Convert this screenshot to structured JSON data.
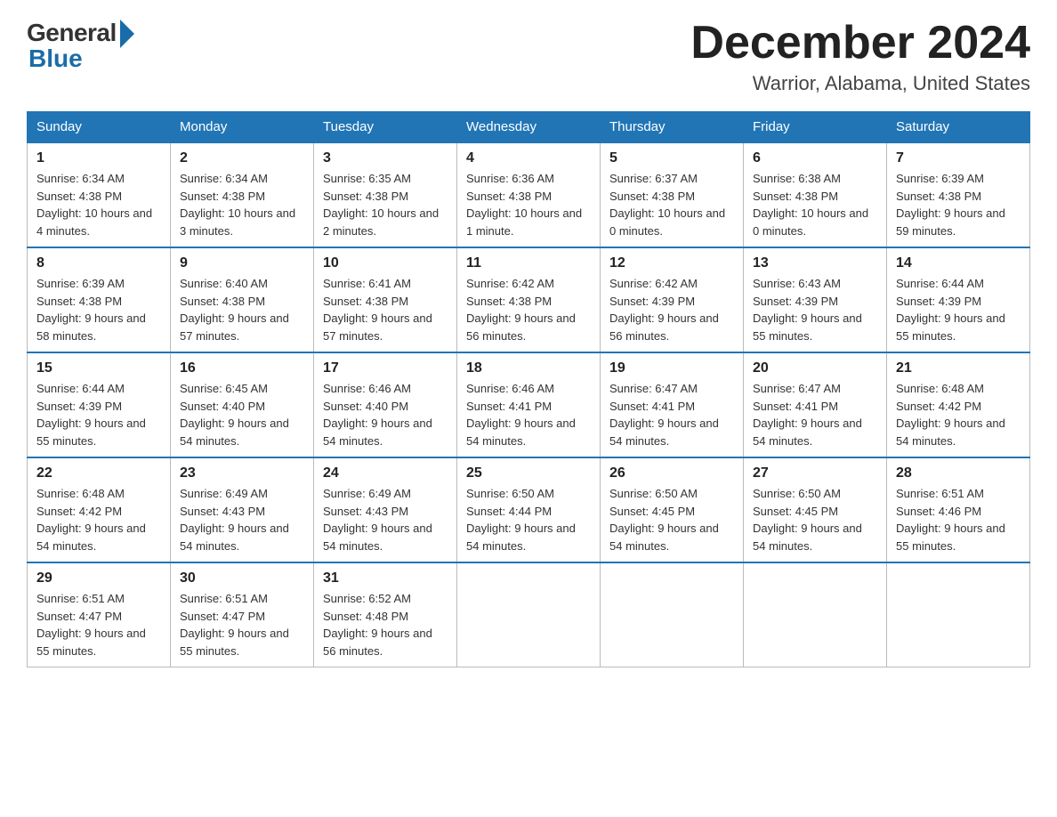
{
  "header": {
    "logo_general": "General",
    "logo_blue": "Blue",
    "month_title": "December 2024",
    "location": "Warrior, Alabama, United States"
  },
  "calendar": {
    "days_of_week": [
      "Sunday",
      "Monday",
      "Tuesday",
      "Wednesday",
      "Thursday",
      "Friday",
      "Saturday"
    ],
    "weeks": [
      [
        {
          "day": "1",
          "sunrise": "6:34 AM",
          "sunset": "4:38 PM",
          "daylight": "10 hours and 4 minutes."
        },
        {
          "day": "2",
          "sunrise": "6:34 AM",
          "sunset": "4:38 PM",
          "daylight": "10 hours and 3 minutes."
        },
        {
          "day": "3",
          "sunrise": "6:35 AM",
          "sunset": "4:38 PM",
          "daylight": "10 hours and 2 minutes."
        },
        {
          "day": "4",
          "sunrise": "6:36 AM",
          "sunset": "4:38 PM",
          "daylight": "10 hours and 1 minute."
        },
        {
          "day": "5",
          "sunrise": "6:37 AM",
          "sunset": "4:38 PM",
          "daylight": "10 hours and 0 minutes."
        },
        {
          "day": "6",
          "sunrise": "6:38 AM",
          "sunset": "4:38 PM",
          "daylight": "10 hours and 0 minutes."
        },
        {
          "day": "7",
          "sunrise": "6:39 AM",
          "sunset": "4:38 PM",
          "daylight": "9 hours and 59 minutes."
        }
      ],
      [
        {
          "day": "8",
          "sunrise": "6:39 AM",
          "sunset": "4:38 PM",
          "daylight": "9 hours and 58 minutes."
        },
        {
          "day": "9",
          "sunrise": "6:40 AM",
          "sunset": "4:38 PM",
          "daylight": "9 hours and 57 minutes."
        },
        {
          "day": "10",
          "sunrise": "6:41 AM",
          "sunset": "4:38 PM",
          "daylight": "9 hours and 57 minutes."
        },
        {
          "day": "11",
          "sunrise": "6:42 AM",
          "sunset": "4:38 PM",
          "daylight": "9 hours and 56 minutes."
        },
        {
          "day": "12",
          "sunrise": "6:42 AM",
          "sunset": "4:39 PM",
          "daylight": "9 hours and 56 minutes."
        },
        {
          "day": "13",
          "sunrise": "6:43 AM",
          "sunset": "4:39 PM",
          "daylight": "9 hours and 55 minutes."
        },
        {
          "day": "14",
          "sunrise": "6:44 AM",
          "sunset": "4:39 PM",
          "daylight": "9 hours and 55 minutes."
        }
      ],
      [
        {
          "day": "15",
          "sunrise": "6:44 AM",
          "sunset": "4:39 PM",
          "daylight": "9 hours and 55 minutes."
        },
        {
          "day": "16",
          "sunrise": "6:45 AM",
          "sunset": "4:40 PM",
          "daylight": "9 hours and 54 minutes."
        },
        {
          "day": "17",
          "sunrise": "6:46 AM",
          "sunset": "4:40 PM",
          "daylight": "9 hours and 54 minutes."
        },
        {
          "day": "18",
          "sunrise": "6:46 AM",
          "sunset": "4:41 PM",
          "daylight": "9 hours and 54 minutes."
        },
        {
          "day": "19",
          "sunrise": "6:47 AM",
          "sunset": "4:41 PM",
          "daylight": "9 hours and 54 minutes."
        },
        {
          "day": "20",
          "sunrise": "6:47 AM",
          "sunset": "4:41 PM",
          "daylight": "9 hours and 54 minutes."
        },
        {
          "day": "21",
          "sunrise": "6:48 AM",
          "sunset": "4:42 PM",
          "daylight": "9 hours and 54 minutes."
        }
      ],
      [
        {
          "day": "22",
          "sunrise": "6:48 AM",
          "sunset": "4:42 PM",
          "daylight": "9 hours and 54 minutes."
        },
        {
          "day": "23",
          "sunrise": "6:49 AM",
          "sunset": "4:43 PM",
          "daylight": "9 hours and 54 minutes."
        },
        {
          "day": "24",
          "sunrise": "6:49 AM",
          "sunset": "4:43 PM",
          "daylight": "9 hours and 54 minutes."
        },
        {
          "day": "25",
          "sunrise": "6:50 AM",
          "sunset": "4:44 PM",
          "daylight": "9 hours and 54 minutes."
        },
        {
          "day": "26",
          "sunrise": "6:50 AM",
          "sunset": "4:45 PM",
          "daylight": "9 hours and 54 minutes."
        },
        {
          "day": "27",
          "sunrise": "6:50 AM",
          "sunset": "4:45 PM",
          "daylight": "9 hours and 54 minutes."
        },
        {
          "day": "28",
          "sunrise": "6:51 AM",
          "sunset": "4:46 PM",
          "daylight": "9 hours and 55 minutes."
        }
      ],
      [
        {
          "day": "29",
          "sunrise": "6:51 AM",
          "sunset": "4:47 PM",
          "daylight": "9 hours and 55 minutes."
        },
        {
          "day": "30",
          "sunrise": "6:51 AM",
          "sunset": "4:47 PM",
          "daylight": "9 hours and 55 minutes."
        },
        {
          "day": "31",
          "sunrise": "6:52 AM",
          "sunset": "4:48 PM",
          "daylight": "9 hours and 56 minutes."
        },
        null,
        null,
        null,
        null
      ]
    ]
  }
}
